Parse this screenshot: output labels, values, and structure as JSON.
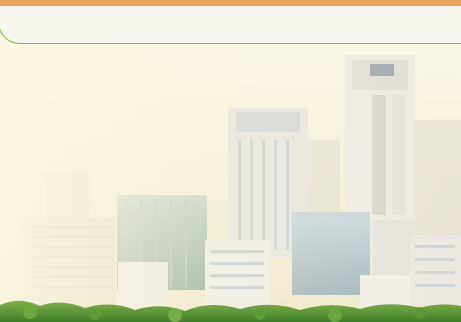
{
  "theme": {
    "strip_color": "#e7a35d",
    "bar_border_color": "#7bc043",
    "bar_fill": "#f7f6ee",
    "sky_top": "#f8f5e4",
    "sky_bottom": "#f1ead0",
    "tree_color": "#5c9a3a"
  },
  "header_bar": {
    "title": ""
  },
  "scene": {
    "description_icon": "city-skyline-background"
  }
}
